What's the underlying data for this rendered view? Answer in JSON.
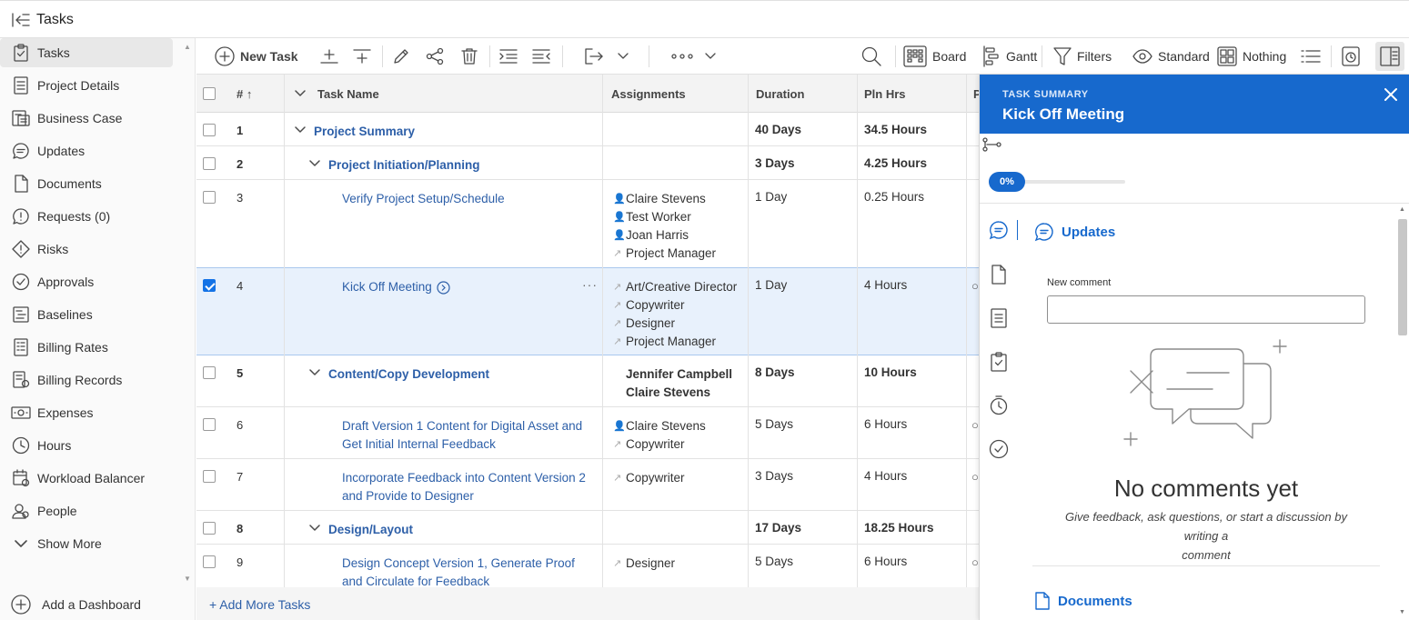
{
  "topbar": {
    "title": "Tasks"
  },
  "sidebar": {
    "items": [
      {
        "label": "Tasks",
        "icon": "tasks-icon"
      },
      {
        "label": "Project Details",
        "icon": "document-lines-icon"
      },
      {
        "label": "Business Case",
        "icon": "business-case-icon"
      },
      {
        "label": "Updates",
        "icon": "chat-icon"
      },
      {
        "label": "Documents",
        "icon": "document-icon"
      },
      {
        "label": "Requests (0)",
        "icon": "request-icon"
      },
      {
        "label": "Risks",
        "icon": "risk-icon"
      },
      {
        "label": "Approvals",
        "icon": "approval-icon"
      },
      {
        "label": "Baselines",
        "icon": "baseline-icon"
      },
      {
        "label": "Billing Rates",
        "icon": "billing-rates-icon"
      },
      {
        "label": "Billing Records",
        "icon": "billing-records-icon"
      },
      {
        "label": "Expenses",
        "icon": "expenses-icon"
      },
      {
        "label": "Hours",
        "icon": "clock-icon"
      },
      {
        "label": "Workload Balancer",
        "icon": "calendar-icon"
      },
      {
        "label": "People",
        "icon": "people-icon"
      },
      {
        "label": "Show More",
        "icon": "chevron-down-icon"
      }
    ],
    "add_dashboard": "Add a Dashboard"
  },
  "toolbar": {
    "new_task": "New Task",
    "board": "Board",
    "gantt": "Gantt",
    "filters": "Filters",
    "standard": "Standard",
    "nothing": "Nothing"
  },
  "table": {
    "headers": {
      "num": "#",
      "task_name": "Task Name",
      "assignments": "Assignments",
      "duration": "Duration",
      "pln_hrs": "Pln Hrs",
      "p": "P"
    },
    "rows": [
      {
        "num": "1",
        "name": "Project Summary",
        "assignments": [],
        "duration": "40 Days",
        "hours": "34.5 Hours"
      },
      {
        "num": "2",
        "name": "Project Initiation/Planning",
        "assignments": [],
        "duration": "3 Days",
        "hours": "4.25 Hours"
      },
      {
        "num": "3",
        "name": "Verify Project Setup/Schedule",
        "assignments": [
          "Claire Stevens",
          "Test Worker",
          "Joan Harris",
          "Project Manager"
        ],
        "duration": "1 Day",
        "hours": "0.25 Hours"
      },
      {
        "num": "4",
        "name": "Kick Off Meeting",
        "assignments": [
          "Art/Creative Director",
          "Copywriter",
          "Designer",
          "Project Manager"
        ],
        "duration": "1 Day",
        "hours": "4 Hours"
      },
      {
        "num": "5",
        "name": "Content/Copy Development",
        "assignments": [
          "Jennifer Campbell",
          "Claire Stevens"
        ],
        "duration": "8 Days",
        "hours": "10 Hours"
      },
      {
        "num": "6",
        "name_l1": "Draft Version 1 Content for Digital Asset and",
        "name_l2": "Get Initial Internal Feedback",
        "assignments": [
          "Claire Stevens",
          "Copywriter"
        ],
        "duration": "5 Days",
        "hours": "6 Hours"
      },
      {
        "num": "7",
        "name_l1": "Incorporate Feedback into Content Version 2",
        "name_l2": "and Provide to Designer",
        "assignments": [
          "Copywriter"
        ],
        "duration": "3 Days",
        "hours": "4 Hours"
      },
      {
        "num": "8",
        "name": "Design/Layout",
        "assignments": [],
        "duration": "17 Days",
        "hours": "18.25 Hours"
      },
      {
        "num": "9",
        "name_l1": "Design Concept Version 1, Generate Proof",
        "name_l2": "and Circulate for Feedback",
        "assignments": [
          "Designer"
        ],
        "duration": "5 Days",
        "hours": "6 Hours"
      }
    ],
    "add_more": "+ Add More Tasks"
  },
  "panel": {
    "kicker": "TASK SUMMARY",
    "title": "Kick Off Meeting",
    "progress": "0%",
    "progress_fraction": 0,
    "updates_title": "Updates",
    "new_comment_label": "New comment",
    "empty_title": "No comments yet",
    "empty_sub_l1": "Give feedback, ask questions, or start a discussion by writing a",
    "empty_sub_l2": "comment",
    "documents_title": "Documents"
  },
  "colors": {
    "accent": "#1769cd",
    "link": "#2d5fa8",
    "selected_row": "#e8f1fc"
  }
}
